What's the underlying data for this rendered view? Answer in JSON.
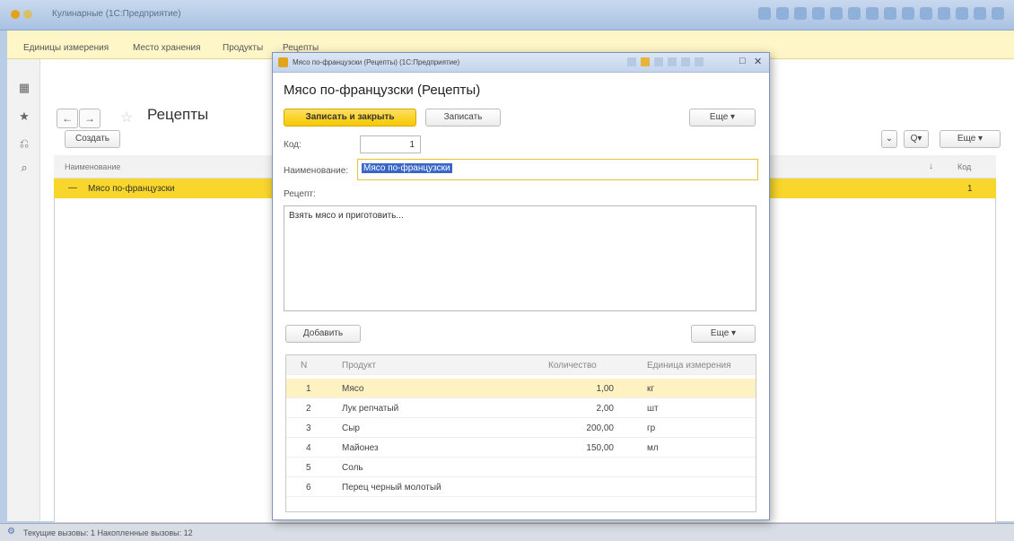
{
  "window": {
    "title": "Кулинарные (1С:Предприятие)"
  },
  "menu": [
    "Единицы измерения",
    "Место хранения",
    "Продукты",
    "Рецепты"
  ],
  "list": {
    "title": "Рецепты",
    "create_label": "Создать",
    "more_label": "Еще",
    "search_label": "Q",
    "columns": {
      "name": "Наименование",
      "code": "Код"
    },
    "row": {
      "name": "Мясо по-французски",
      "code": "1"
    }
  },
  "dialog": {
    "window_title": "Мясо по-французски (Рецепты) (1С:Предприятие)",
    "heading": "Мясо по-французски (Рецепты)",
    "save_close_label": "Записать и закрыть",
    "save_label": "Записать",
    "more_label": "Еще",
    "code_label": "Код:",
    "code_value": "1",
    "name_label": "Наименование:",
    "name_value": "Мясо по-французски",
    "recipe_label": "Рецепт:",
    "recipe_text": "Взять мясо и приготовить...",
    "add_label": "Добавить",
    "table": {
      "headers": {
        "n": "N",
        "product": "Продукт",
        "qty": "Количество",
        "unit": "Единица измерения"
      },
      "rows": [
        {
          "n": "1",
          "product": "Мясо",
          "qty": "1,00",
          "unit": "кг"
        },
        {
          "n": "2",
          "product": "Лук репчатый",
          "qty": "2,00",
          "unit": "шт"
        },
        {
          "n": "3",
          "product": "Сыр",
          "qty": "200,00",
          "unit": "гр"
        },
        {
          "n": "4",
          "product": "Майонез",
          "qty": "150,00",
          "unit": "мл"
        },
        {
          "n": "5",
          "product": "Соль",
          "qty": "",
          "unit": ""
        },
        {
          "n": "6",
          "product": "Перец черный молотый",
          "qty": "",
          "unit": ""
        }
      ]
    }
  },
  "status": "Текущие вызовы: 1   Накопленные вызовы: 12"
}
